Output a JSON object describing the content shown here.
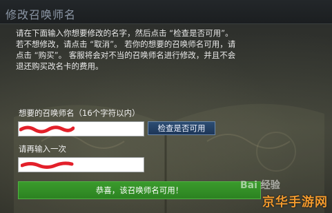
{
  "dialog": {
    "title": "修改召唤师名",
    "description": [
      "请在下面输入你想要修改的名字，然后点击 “检查是否可用”。",
      "若不想修改，请点击 “取消”。 若你的想要的召唤师名可用，请",
      "点击 “购买”。 客服将会对不当的召唤师名进行修改，并且不会",
      "退还购买改名卡的费用。"
    ]
  },
  "form": {
    "name_label": "想要的召唤师名（16个字符以内）",
    "name_value": "",
    "confirm_label": "请再输入一次",
    "confirm_value": "",
    "check_button_label": "检查是否可用"
  },
  "status": {
    "message": "恭喜，该召唤师名可用！",
    "color": "#2c8221"
  },
  "watermarks": {
    "baidu": "Bai 经验",
    "site": "京华手游网"
  },
  "colors": {
    "title": "#8c97a6",
    "button": "#1d3658",
    "redaction": "#e3202a"
  }
}
